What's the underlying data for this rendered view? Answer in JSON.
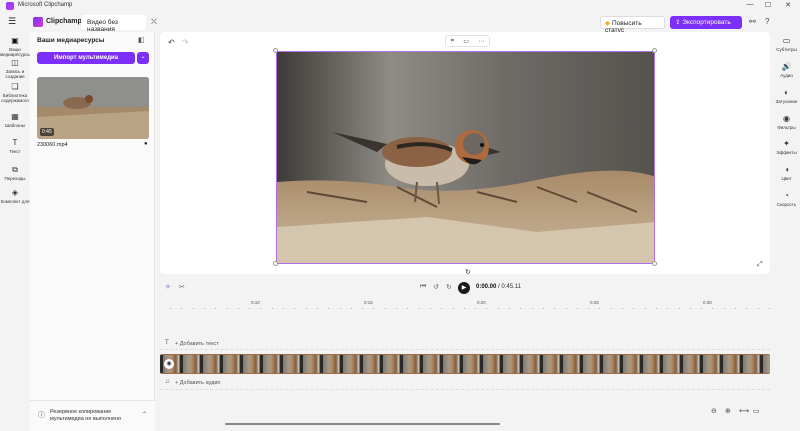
{
  "window": {
    "title": "Microsoft Clipchamp",
    "minimize": "—",
    "maximize": "☐",
    "close": "✕"
  },
  "header": {
    "brand": "Clipchamp",
    "project_title": "Видео без названия",
    "upgrade_label": "Повысить статус",
    "export_label": "Экспортировать"
  },
  "left_rail": [
    {
      "icon": "media-icon",
      "glyph": "▣",
      "label": "Ваши медиаресурсы"
    },
    {
      "icon": "record-icon",
      "glyph": "◫",
      "label": "Запись и создание"
    },
    {
      "icon": "content-library-icon",
      "glyph": "❏",
      "label": "Библиотека содержимого"
    },
    {
      "icon": "templates-icon",
      "glyph": "▦",
      "label": "Шаблоны"
    },
    {
      "icon": "text-icon",
      "glyph": "T",
      "label": "Текст"
    },
    {
      "icon": "transitions-icon",
      "glyph": "⧉",
      "label": "Переходы"
    },
    {
      "icon": "brand-kit-icon",
      "glyph": "◈",
      "label": "Комплект для"
    }
  ],
  "media_panel": {
    "title": "Ваши медиаресурсы",
    "import_label": "Импорт мультимедиа",
    "import_more": "⌄",
    "item": {
      "name": "230060.mp4",
      "duration": "0:45"
    },
    "backup_text": "Резервное копирование мультимедиа не выполнено"
  },
  "preview": {
    "colors": {
      "accent": "#7b2ff7",
      "frame_border": "#b06ee8"
    }
  },
  "controls": {
    "current_time": "0:00.00",
    "total_time": "/ 0:45.11"
  },
  "ruler": [
    "0:10",
    "0:15",
    "0:20",
    "0:25",
    "0:30"
  ],
  "timeline": {
    "add_text": "+ Добавить текст",
    "add_audio": "+ Добавить аудио"
  },
  "right_rail": [
    {
      "icon": "captions-icon",
      "glyph": "▭",
      "label": "Субтитры"
    },
    {
      "icon": "audio-icon",
      "glyph": "🔊",
      "label": "Аудио"
    },
    {
      "icon": "fade-icon",
      "glyph": "◐",
      "label": "Затухание"
    },
    {
      "icon": "filters-icon",
      "glyph": "◉",
      "label": "Фильтры"
    },
    {
      "icon": "effects-icon",
      "glyph": "✦",
      "label": "Эффекты"
    },
    {
      "icon": "color-icon",
      "glyph": "◑",
      "label": "Цвет"
    },
    {
      "icon": "speed-icon",
      "glyph": "◔",
      "label": "Скорость"
    }
  ]
}
